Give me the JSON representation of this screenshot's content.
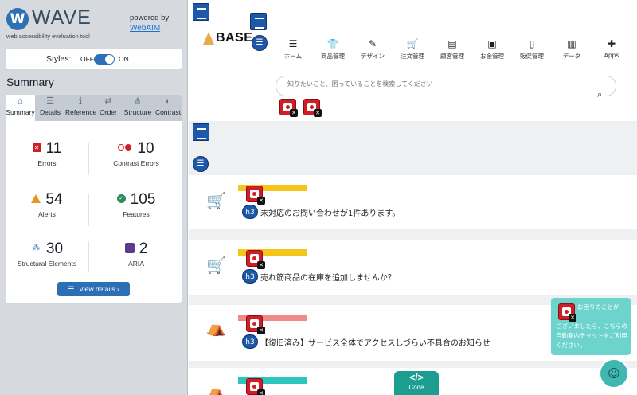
{
  "wave": {
    "logo_letter": "W",
    "title": "WAVE",
    "tagline": "web accessibility evaluation tool",
    "powered_by": "powered by",
    "webaim_link": "WebAIM",
    "styles_label": "Styles:",
    "styles_off": "OFF",
    "styles_on": "ON",
    "styles_state": "on",
    "summary_title": "Summary",
    "tabs": [
      {
        "label": "Summary",
        "icon": "home-icon",
        "glyph": "⌂"
      },
      {
        "label": "Details",
        "icon": "list-icon",
        "glyph": "☰"
      },
      {
        "label": "Reference",
        "icon": "info-icon",
        "glyph": "ℹ"
      },
      {
        "label": "Order",
        "icon": "order-icon",
        "glyph": "⇄"
      },
      {
        "label": "Structure",
        "icon": "structure-icon",
        "glyph": "⋔"
      },
      {
        "label": "Contrast",
        "icon": "contrast-icon",
        "glyph": "◐"
      }
    ],
    "active_tab": "Summary",
    "stats": {
      "errors": {
        "value": "11",
        "label": "Errors"
      },
      "contrast_errors": {
        "value": "10",
        "label": "Contrast Errors"
      },
      "alerts": {
        "value": "54",
        "label": "Alerts"
      },
      "features": {
        "value": "105",
        "label": "Features"
      },
      "structural": {
        "value": "30",
        "label": "Structural Elements"
      },
      "aria": {
        "value": "2",
        "label": "ARIA"
      }
    },
    "view_details": "View details ›"
  },
  "page": {
    "logo_text": "BASE",
    "menu": [
      {
        "label": "ホーム",
        "icon": "list-icon",
        "glyph": "☰"
      },
      {
        "label": "商品管理",
        "icon": "shirt-icon",
        "glyph": "👕"
      },
      {
        "label": "デザイン",
        "icon": "brush-icon",
        "glyph": "✎"
      },
      {
        "label": "注文管理",
        "icon": "cart-icon",
        "glyph": "🛒"
      },
      {
        "label": "顧客管理",
        "icon": "id-card-icon",
        "glyph": "▤"
      },
      {
        "label": "お金管理",
        "icon": "wallet-icon",
        "glyph": "▣"
      },
      {
        "label": "販促管理",
        "icon": "phone-icon",
        "glyph": "▯"
      },
      {
        "label": "データ",
        "icon": "chart-icon",
        "glyph": "▥"
      },
      {
        "label": "Apps",
        "icon": "puzzle-icon",
        "glyph": "✚"
      }
    ],
    "search_placeholder": "知りたいこと、困っていることを検索してください",
    "cards": [
      {
        "badge": "h3",
        "text": "未対応のお問い合わせが1件あります。",
        "bar_color": "#f5c51b"
      },
      {
        "badge": "h3",
        "text": "売れ筋商品の在庫を追加しませんか？",
        "bar_color": "#f5c51b"
      },
      {
        "badge": "h3",
        "text": "【復旧済み】サービス全体でアクセスしづらい不具合のお知らせ",
        "bar_color": "#f08a8a"
      },
      {
        "badge": "",
        "text": "",
        "bar_color": "#2cc6bd"
      }
    ],
    "chat_line1": "お困りのことが",
    "chat_line2": "ございましたら、こちらの自動案内チャットをご利用ください。",
    "code_label": "Code",
    "code_glyph": "</>"
  }
}
